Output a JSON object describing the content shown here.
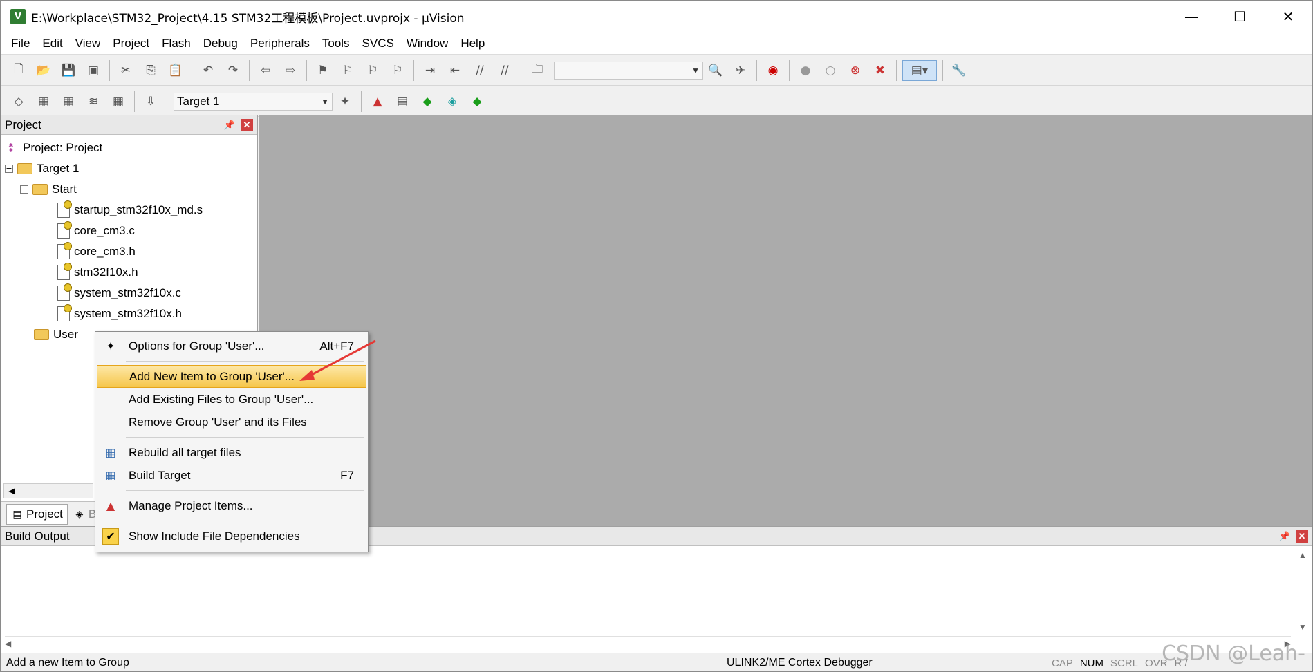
{
  "window": {
    "title": "E:\\Workplace\\STM32_Project\\4.15 STM32工程模板\\Project.uvprojx - µVision",
    "icon_label": "V",
    "minimize_icon": "minimize-icon",
    "maximize_icon": "maximize-icon",
    "close_icon": "close-icon"
  },
  "menu": [
    "File",
    "Edit",
    "View",
    "Project",
    "Flash",
    "Debug",
    "Peripherals",
    "Tools",
    "SVCS",
    "Window",
    "Help"
  ],
  "toolbar2": {
    "target_select": "Target 1"
  },
  "project_panel": {
    "title": "Project",
    "tree": {
      "root": "Project: Project",
      "target": "Target 1",
      "group_start": "Start",
      "files": [
        "startup_stm32f10x_md.s",
        "core_cm3.c",
        "core_cm3.h",
        "stm32f10x.h",
        "system_stm32f10x.c",
        "system_stm32f10x.h"
      ],
      "group_user": "User"
    },
    "tabs": [
      "Project",
      "B"
    ]
  },
  "context_menu": {
    "items": [
      {
        "label": "Options for Group 'User'...",
        "shortcut": "Alt+F7",
        "icon": "wand-icon"
      },
      {
        "label": "Add New  Item to Group 'User'...",
        "shortcut": "",
        "icon": ""
      },
      {
        "label": "Add Existing Files to Group 'User'...",
        "shortcut": "",
        "icon": ""
      },
      {
        "label": "Remove Group 'User' and its Files",
        "shortcut": "",
        "icon": ""
      },
      {
        "label": "Rebuild all target files",
        "shortcut": "",
        "icon": "rebuild-icon"
      },
      {
        "label": "Build Target",
        "shortcut": "F7",
        "icon": "build-icon"
      },
      {
        "label": "Manage Project Items...",
        "shortcut": "",
        "icon": "manage-items-icon"
      },
      {
        "label": "Show Include File Dependencies",
        "shortcut": "",
        "icon": "checkmark-icon"
      }
    ],
    "highlighted_index": 1,
    "annotation_arrow_color": "#e53935"
  },
  "build_output": {
    "title": "Build Output"
  },
  "statusbar": {
    "message": "Add a new Item to Group",
    "debugger": "ULINK2/ME Cortex Debugger",
    "flags": [
      "CAP",
      "NUM",
      "SCRL",
      "OVR",
      "R /"
    ]
  },
  "watermark": "CSDN @Leah-",
  "colors": {
    "highlight": "#f6c64a",
    "editor_bg": "#ababab",
    "close_red": "#d04040"
  }
}
